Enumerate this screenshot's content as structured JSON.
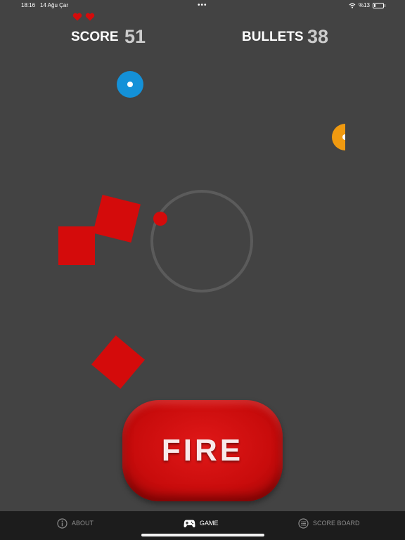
{
  "status_bar": {
    "time": "18:16",
    "date": "14 Ağu Çar",
    "dots": "•••",
    "battery_text": "%13",
    "battery_level": 0.13
  },
  "hud": {
    "lives": 2,
    "score_label": "SCORE",
    "score_value": "51",
    "bullets_label": "BULLETS",
    "bullets_value": "38"
  },
  "fire_button": {
    "label": "FIRE"
  },
  "tabs": [
    {
      "label": "ABOUT",
      "icon": "info-icon",
      "active": false
    },
    {
      "label": "GAME",
      "icon": "gamepad-icon",
      "active": true
    },
    {
      "label": "SCORE BOARD",
      "icon": "list-icon",
      "active": false
    }
  ],
  "colors": {
    "background": "#434343",
    "enemy": "#d40b0b",
    "blue_target": "#1491d8",
    "orange_target": "#f09a10",
    "ring": "#5b5b5b",
    "tab_bar": "#1c1c1c"
  }
}
